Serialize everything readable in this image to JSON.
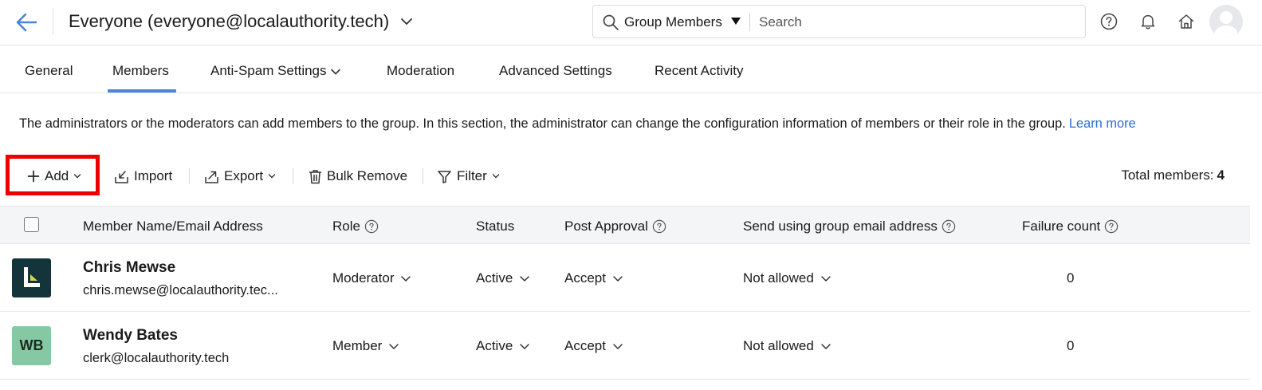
{
  "header": {
    "group_title": "Everyone (everyone@localauthority.tech)",
    "search_scope": "Group Members",
    "search_placeholder": "Search"
  },
  "tabs": [
    {
      "label": "General"
    },
    {
      "label": "Members",
      "active": true
    },
    {
      "label": "Anti-Spam Settings",
      "has_dropdown": true
    },
    {
      "label": "Moderation"
    },
    {
      "label": "Advanced Settings"
    },
    {
      "label": "Recent Activity"
    }
  ],
  "description": {
    "text": "The administrators or the moderators can add members to the group. In this section, the administrator can change the configuration information of members or their role in the group.",
    "link": "Learn more"
  },
  "toolbar": {
    "add": "Add",
    "import": "Import",
    "export": "Export",
    "bulk_remove": "Bulk Remove",
    "filter": "Filter",
    "total_label": "Total members:",
    "total_value": "4"
  },
  "table": {
    "columns": {
      "member": "Member Name/Email Address",
      "role": "Role",
      "status": "Status",
      "post_approval": "Post Approval",
      "send_using": "Send using group email address",
      "failure_count": "Failure count"
    },
    "rows": [
      {
        "name": "Chris Mewse",
        "email": "chris.mewse@localauthority.tec...",
        "role": "Moderator",
        "status": "Active",
        "post_approval": "Accept",
        "send_using": "Not allowed",
        "failure_count": "0",
        "avatar": "logo-l-icon"
      },
      {
        "name": "Wendy Bates",
        "email": "clerk@localauthority.tech",
        "role": "Member",
        "status": "Active",
        "post_approval": "Accept",
        "send_using": "Not allowed",
        "failure_count": "0",
        "initials": "WB"
      }
    ]
  },
  "colors": {
    "accent": "#4a86d8",
    "link": "#2a6fd6",
    "highlight": "#ee0000",
    "avatar_dark": "#13343a",
    "avatar_green": "#86c8a4"
  }
}
